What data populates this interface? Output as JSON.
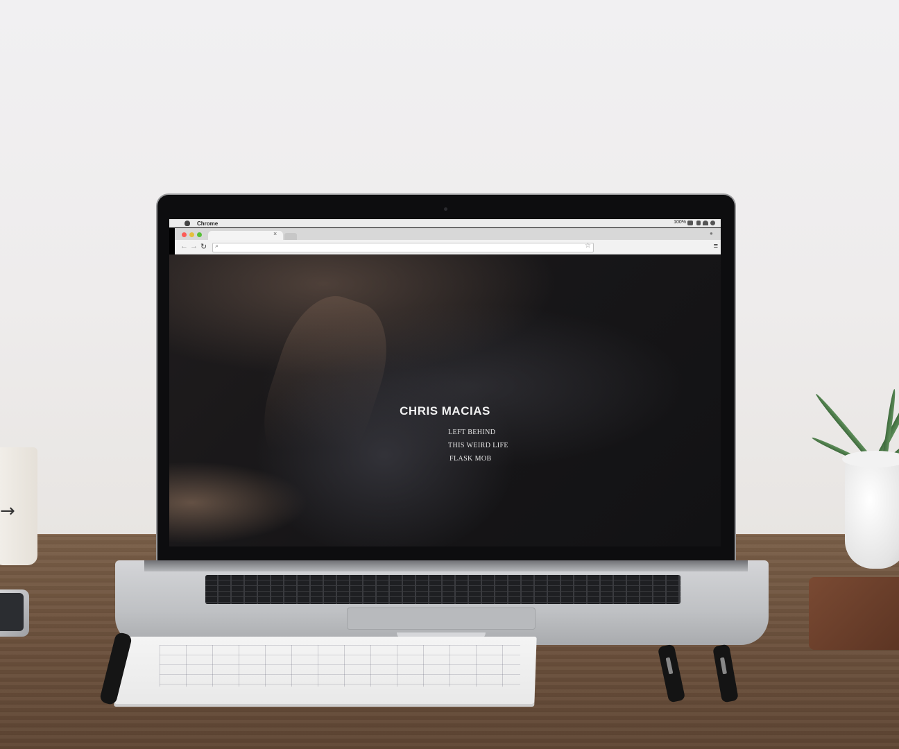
{
  "browser": {
    "menubar_app": "Chrome",
    "menubar_status": "100%"
  },
  "website": {
    "title": "CHRIS MACIAS",
    "nav": [
      "LEFT BEHIND",
      "THIS WEIRD LIFE",
      "FLASK MOB"
    ]
  },
  "icons": {
    "apple": "apple-logo-icon",
    "close": "close-icon",
    "back": "back-arrow-icon",
    "forward": "forward-arrow-icon",
    "reload": "reload-icon",
    "search": "search-icon",
    "star": "star-icon",
    "menu": "hamburger-menu-icon",
    "user": "user-icon"
  },
  "colors": {
    "traffic_red": "#fc5b57",
    "traffic_yellow": "#e5bf3c",
    "traffic_green": "#57c038"
  }
}
